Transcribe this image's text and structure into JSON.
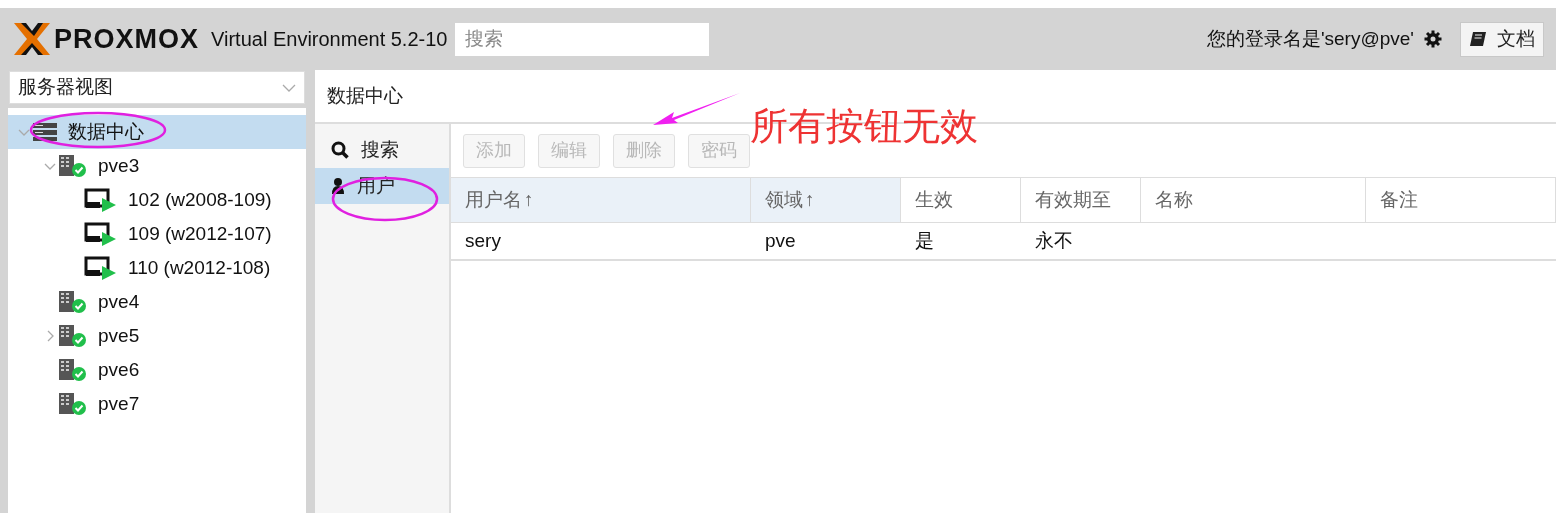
{
  "header": {
    "logo_text": "PROXMOX",
    "product": "Virtual Environment 5.2-10",
    "search": {
      "placeholder": "搜索"
    },
    "user_label": "您的登录名是'sery@pve'",
    "docs_button": "文档"
  },
  "sidebar": {
    "view_select": "服务器视图",
    "tree": [
      {
        "kind": "datacenter",
        "label": "数据中心",
        "expanded": true,
        "selected": true,
        "children": [
          {
            "kind": "node",
            "label": "pve3",
            "expanded": true,
            "selected": false,
            "children": [
              {
                "kind": "vm",
                "label": "102 (w2008-109)",
                "selected": false
              },
              {
                "kind": "vm",
                "label": "109 (w2012-107)",
                "selected": false
              },
              {
                "kind": "vm",
                "label": "110 (w2012-108)",
                "selected": false
              }
            ]
          },
          {
            "kind": "node",
            "label": "pve4",
            "selected": false
          },
          {
            "kind": "node",
            "label": "pve5",
            "expanded": false,
            "selected": false
          },
          {
            "kind": "node",
            "label": "pve6",
            "selected": false
          },
          {
            "kind": "node",
            "label": "pve7",
            "selected": false
          }
        ]
      }
    ]
  },
  "content": {
    "title": "数据中心",
    "nav": [
      {
        "kind": "search",
        "label": "搜索",
        "selected": false
      },
      {
        "kind": "user",
        "label": "用户",
        "selected": true
      }
    ],
    "toolbar": [
      {
        "label": "添加",
        "disabled": true
      },
      {
        "label": "编辑",
        "disabled": true
      },
      {
        "label": "删除",
        "disabled": true
      },
      {
        "label": "密码",
        "disabled": true
      }
    ],
    "table": {
      "columns": [
        {
          "label": "用户名",
          "sort_arrow": "↑",
          "sorted": true
        },
        {
          "label": "领域",
          "sort_arrow": "↑",
          "sorted": true
        },
        {
          "label": "生效",
          "sorted": false
        },
        {
          "label": "有效期至",
          "sorted": false
        },
        {
          "label": "名称",
          "sorted": false
        },
        {
          "label": "备注",
          "sorted": false
        }
      ],
      "rows": [
        [
          "sery",
          "pve",
          "是",
          "永不",
          "",
          ""
        ]
      ]
    }
  },
  "annotation": {
    "text": "所有按钮无效"
  }
}
